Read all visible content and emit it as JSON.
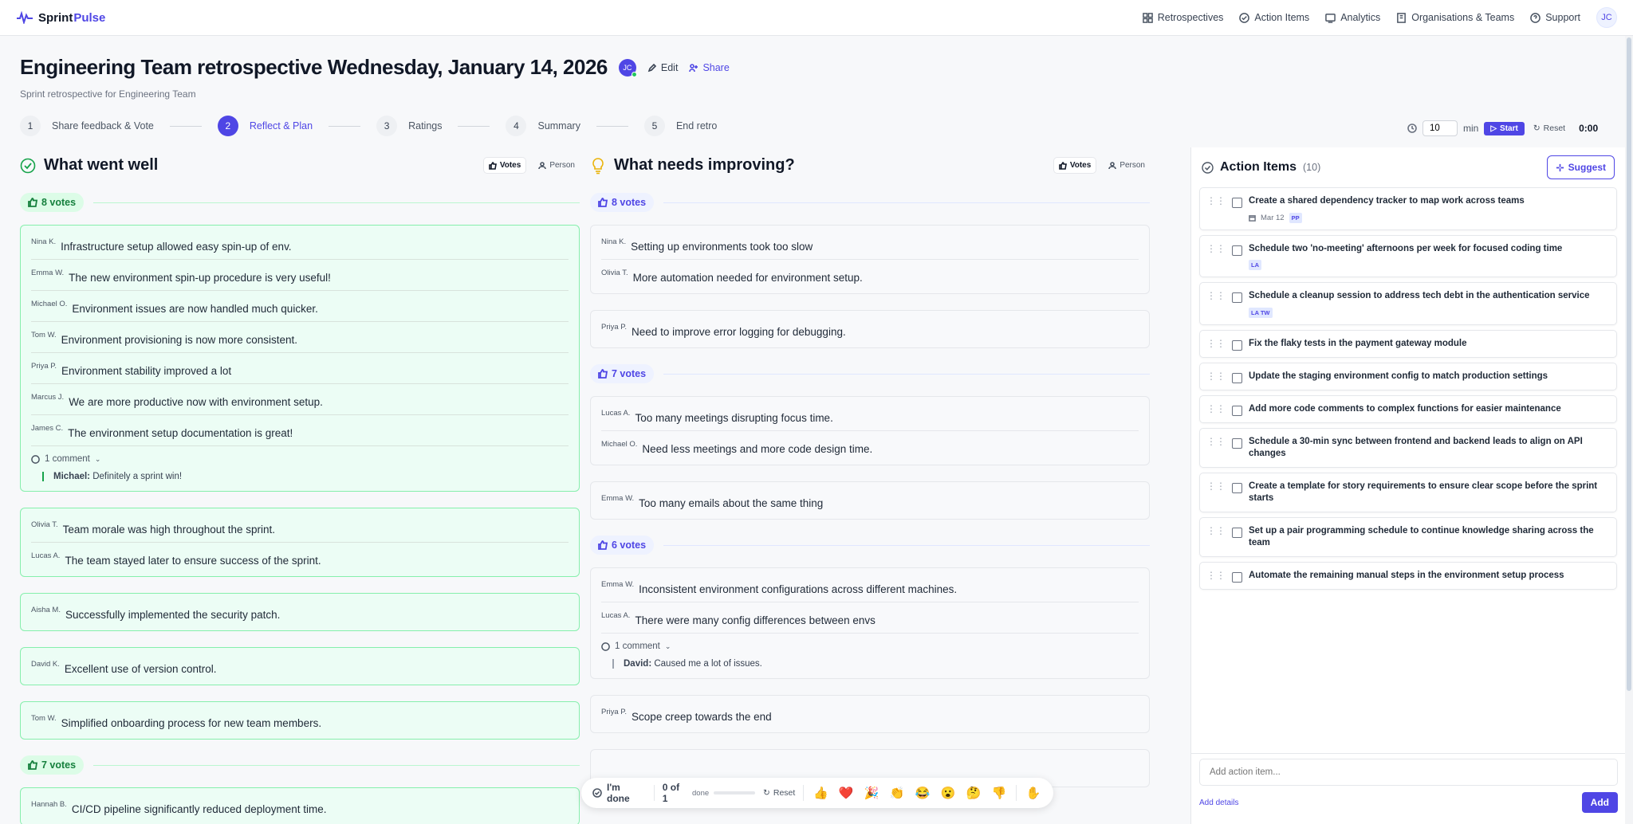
{
  "nav": {
    "logo_prefix": "Sprint",
    "logo_suffix": "Pulse",
    "items": [
      {
        "label": "Retrospectives",
        "icon": "grid-icon"
      },
      {
        "label": "Action Items",
        "icon": "check-circle-icon"
      },
      {
        "label": "Analytics",
        "icon": "chart-icon"
      },
      {
        "label": "Organisations & Teams",
        "icon": "building-icon"
      },
      {
        "label": "Support",
        "icon": "help-icon"
      }
    ],
    "avatar": "JC"
  },
  "header": {
    "title": "Engineering Team retrospective Wednesday, January 14, 2026",
    "avatar": "JC",
    "edit_label": "Edit",
    "share_label": "Share",
    "subtitle": "Sprint retrospective for Engineering Team"
  },
  "steps": [
    {
      "num": "1",
      "label": "Share feedback & Vote"
    },
    {
      "num": "2",
      "label": "Reflect & Plan",
      "active": true
    },
    {
      "num": "3",
      "label": "Ratings"
    },
    {
      "num": "4",
      "label": "Summary"
    },
    {
      "num": "5",
      "label": "End retro"
    }
  ],
  "timer": {
    "minutes": "10",
    "unit": "min",
    "start_label": "Start",
    "reset_label": "Reset",
    "elapsed": "0:00"
  },
  "went_well": {
    "title": "What went well",
    "tool_votes": "Votes",
    "tool_person": "Person",
    "groups": [
      {
        "votes": "8 votes",
        "cards": [
          {
            "entries": [
              {
                "who": "Nina K.",
                "text": "Infrastructure setup allowed easy spin-up of env."
              },
              {
                "who": "Emma W.",
                "text": "The new environment spin-up procedure is very useful!"
              },
              {
                "who": "Michael O.",
                "text": "Environment issues are now handled much quicker."
              },
              {
                "who": "Tom W.",
                "text": "Environment provisioning is now more consistent."
              },
              {
                "who": "Priya P.",
                "text": "Environment stability improved a lot"
              },
              {
                "who": "Marcus J.",
                "text": "We are more productive now with environment setup."
              },
              {
                "who": "James C.",
                "text": "The environment setup documentation is great!"
              }
            ],
            "comments_label": "1 comment",
            "comment_author": "Michael:",
            "comment_text": "Definitely a sprint win!"
          },
          {
            "entries": [
              {
                "who": "Olivia T.",
                "text": "Team morale was high throughout the sprint."
              },
              {
                "who": "Lucas A.",
                "text": "The team stayed later to ensure success of the sprint."
              }
            ]
          },
          {
            "entries": [
              {
                "who": "Aisha M.",
                "text": "Successfully implemented the security patch."
              }
            ]
          },
          {
            "entries": [
              {
                "who": "David K.",
                "text": "Excellent use of version control."
              }
            ]
          },
          {
            "entries": [
              {
                "who": "Tom W.",
                "text": "Simplified onboarding process for new team members."
              }
            ]
          }
        ]
      },
      {
        "votes": "7 votes",
        "cards": [
          {
            "entries": [
              {
                "who": "Hannah B.",
                "text": "CI/CD pipeline significantly reduced deployment time."
              }
            ]
          }
        ]
      }
    ]
  },
  "needs_improving": {
    "title": "What needs improving?",
    "tool_votes": "Votes",
    "tool_person": "Person",
    "groups": [
      {
        "votes": "8 votes",
        "cards": [
          {
            "entries": [
              {
                "who": "Nina K.",
                "text": "Setting up environments took too slow"
              },
              {
                "who": "Olivia T.",
                "text": "More automation needed for environment setup."
              }
            ]
          },
          {
            "entries": [
              {
                "who": "Priya P.",
                "text": "Need to improve error logging for debugging."
              }
            ]
          }
        ]
      },
      {
        "votes": "7 votes",
        "cards": [
          {
            "entries": [
              {
                "who": "Lucas A.",
                "text": "Too many meetings disrupting focus time."
              },
              {
                "who": "Michael O.",
                "text": "Need less meetings and more code design time."
              }
            ]
          },
          {
            "entries": [
              {
                "who": "Emma W.",
                "text": "Too many emails about the same thing"
              }
            ]
          }
        ]
      },
      {
        "votes": "6 votes",
        "cards": [
          {
            "entries": [
              {
                "who": "Emma W.",
                "text": "Inconsistent environment configurations across different machines."
              },
              {
                "who": "Lucas A.",
                "text": "There were many config differences between envs"
              }
            ],
            "comments_label": "1 comment",
            "comment_author": "David:",
            "comment_text": "Caused me a lot of issues."
          },
          {
            "entries": [
              {
                "who": "Priya P.",
                "text": "Scope creep towards the end"
              }
            ]
          },
          {
            "entries": [
              {
                "who": "",
                "text": ""
              }
            ]
          }
        ]
      }
    ]
  },
  "action_items": {
    "title": "Action Items",
    "count": "(10)",
    "suggest_label": "Suggest",
    "items": [
      {
        "text": "Create a shared dependency tracker to map work across teams",
        "date": "Mar 12",
        "tags": [
          "PP"
        ]
      },
      {
        "text": "Schedule two 'no-meeting' afternoons per week for focused coding time",
        "tags": [
          "LA"
        ]
      },
      {
        "text": "Schedule a cleanup session to address tech debt in the authentication service",
        "tags": [
          "LA",
          "TW"
        ]
      },
      {
        "text": "Fix the flaky tests in the payment gateway module"
      },
      {
        "text": "Update the staging environment config to match production settings"
      },
      {
        "text": "Add more code comments to complex functions for easier maintenance"
      },
      {
        "text": "Schedule a 30-min sync between frontend and backend leads to align on API changes"
      },
      {
        "text": "Create a template for story requirements to ensure clear scope before the sprint starts"
      },
      {
        "text": "Set up a pair programming schedule to continue knowledge sharing across the team"
      },
      {
        "text": "Automate the remaining manual steps in the environment setup process"
      }
    ],
    "add_placeholder": "Add action item...",
    "add_details_label": "Add details",
    "add_button": "Add"
  },
  "bottom_bar": {
    "done_label": "I'm done",
    "progress": "0 of 1",
    "progress_suffix": "done",
    "progress_fraction": 0,
    "reset_label": "Reset",
    "reactions": [
      "👍",
      "❤️",
      "🎉",
      "👏",
      "😂",
      "😮",
      "🤔",
      "👎",
      "✋"
    ]
  },
  "colors": {
    "accent": "#4f46e5",
    "positive": "#16a34a",
    "positive_bg": "#ecfdf5"
  }
}
